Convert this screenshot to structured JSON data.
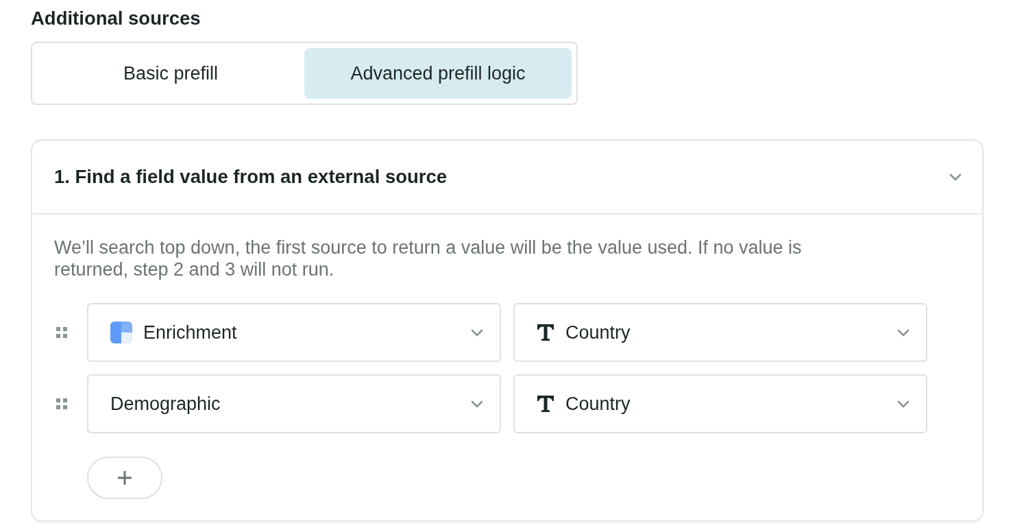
{
  "heading": "Additional sources",
  "tabs": [
    {
      "label": "Basic prefill",
      "selected": false
    },
    {
      "label": "Advanced prefill logic",
      "selected": true
    }
  ],
  "section": {
    "title": "1. Find a field value from an external source",
    "expanded": true,
    "description": "We’ll search top down, the first source to return a value will be the value used. If no value is returned, step 2 and 3 will not run.",
    "rows": [
      {
        "source": {
          "kind": "enrichment",
          "value": "Enrichment"
        },
        "field": {
          "kind": "text",
          "value": "Country"
        }
      },
      {
        "source": {
          "kind": "plain",
          "value": "Demographic"
        },
        "field": {
          "kind": "text",
          "value": "Country"
        }
      }
    ]
  }
}
